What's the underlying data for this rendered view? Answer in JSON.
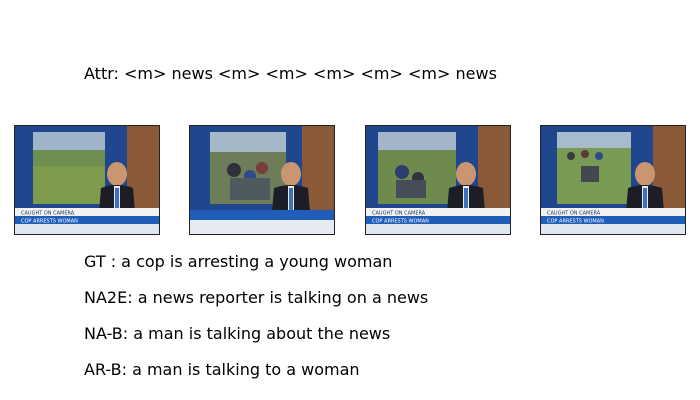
{
  "attr": {
    "label": "Attr",
    "tokens": [
      "<m>",
      "news",
      "<m>",
      "<m>",
      "<m>",
      "<m>",
      "<m>",
      "news"
    ]
  },
  "frames": [
    {
      "ticker_line_1": "CAUGHT ON CAMERA",
      "ticker_line_2": "COP ARRESTS WOMAN"
    },
    {
      "ticker_line_1": "",
      "ticker_line_2": ""
    },
    {
      "ticker_line_1": "CAUGHT ON CAMERA",
      "ticker_line_2": "COP ARRESTS WOMAN"
    },
    {
      "ticker_line_1": "CAUGHT ON CAMERA",
      "ticker_line_2": "COP ARRESTS WOMAN"
    }
  ],
  "captions": [
    {
      "label": "GT ",
      "text": "a cop is arresting a young woman"
    },
    {
      "label": "NA2E",
      "text": "a news reporter is talking on a news"
    },
    {
      "label": "NA-B",
      "text": "a man is talking about the news"
    },
    {
      "label": "AR-B",
      "text": "a man is talking to a woman"
    }
  ]
}
